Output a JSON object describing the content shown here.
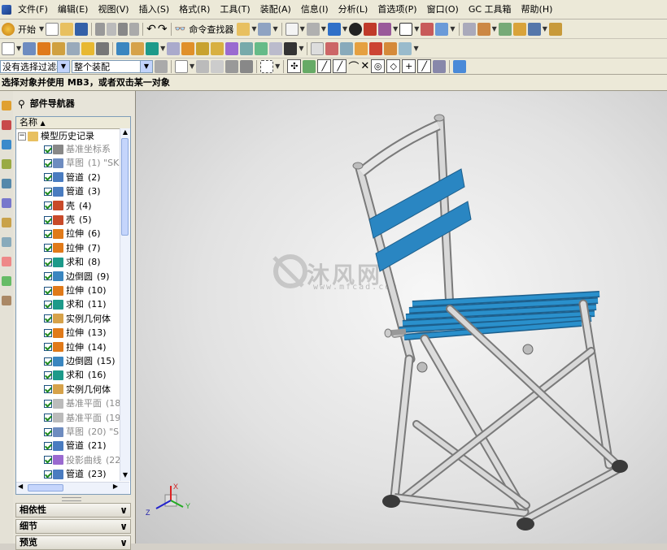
{
  "menubar": {
    "items": [
      "文件(F)",
      "编辑(E)",
      "视图(V)",
      "插入(S)",
      "格式(R)",
      "工具(T)",
      "装配(A)",
      "信息(I)",
      "分析(L)",
      "首选项(P)",
      "窗口(O)",
      "GC 工具箱",
      "帮助(H)"
    ]
  },
  "toolbar": {
    "start_label": "开始",
    "command_finder_label": "命令查找器"
  },
  "selection_bar": {
    "filter_value": "没有选择过滤器",
    "scope_value": "整个装配"
  },
  "cue_line": "选择对象并使用 MB3，或者双击某一对象",
  "navigator": {
    "title": "部件导航器",
    "column_name": "名称",
    "root_label": "模型历史记录",
    "rows": [
      {
        "label": "基准坐标系",
        "num": "",
        "gray": true,
        "icon": "datum-csys-icon"
      },
      {
        "label": "草图",
        "num": "(1) \"SK",
        "gray": true,
        "icon": "sketch-icon"
      },
      {
        "label": "管道",
        "num": "(2)",
        "gray": false,
        "icon": "tube-icon"
      },
      {
        "label": "管道",
        "num": "(3)",
        "gray": false,
        "icon": "tube-icon"
      },
      {
        "label": "壳",
        "num": "(4)",
        "gray": false,
        "icon": "shell-icon"
      },
      {
        "label": "壳",
        "num": "(5)",
        "gray": false,
        "icon": "shell-icon"
      },
      {
        "label": "拉伸",
        "num": "(6)",
        "gray": false,
        "icon": "extrude-icon"
      },
      {
        "label": "拉伸",
        "num": "(7)",
        "gray": false,
        "icon": "extrude-icon"
      },
      {
        "label": "求和",
        "num": "(8)",
        "gray": false,
        "icon": "unite-icon"
      },
      {
        "label": "边倒圆",
        "num": "(9)",
        "gray": false,
        "icon": "edge-blend-icon"
      },
      {
        "label": "拉伸",
        "num": "(10)",
        "gray": false,
        "icon": "extrude-icon"
      },
      {
        "label": "求和",
        "num": "(11)",
        "gray": false,
        "icon": "unite-icon"
      },
      {
        "label": "实例几何体",
        "num": "",
        "gray": false,
        "icon": "instance-geometry-icon"
      },
      {
        "label": "拉伸",
        "num": "(13)",
        "gray": false,
        "icon": "extrude-icon"
      },
      {
        "label": "拉伸",
        "num": "(14)",
        "gray": false,
        "icon": "extrude-icon"
      },
      {
        "label": "边倒圆",
        "num": "(15)",
        "gray": false,
        "icon": "edge-blend-icon"
      },
      {
        "label": "求和",
        "num": "(16)",
        "gray": false,
        "icon": "unite-icon"
      },
      {
        "label": "实例几何体",
        "num": "",
        "gray": false,
        "icon": "instance-geometry-icon"
      },
      {
        "label": "基准平面",
        "num": "(18",
        "gray": true,
        "icon": "datum-plane-icon"
      },
      {
        "label": "基准平面",
        "num": "(19",
        "gray": true,
        "icon": "datum-plane-icon"
      },
      {
        "label": "草图",
        "num": "(20) \"S",
        "gray": true,
        "icon": "sketch-icon"
      },
      {
        "label": "管道",
        "num": "(21)",
        "gray": false,
        "icon": "tube-icon"
      },
      {
        "label": "投影曲线",
        "num": "(22",
        "gray": true,
        "icon": "projected-curve-icon"
      },
      {
        "label": "管道",
        "num": "(23)",
        "gray": false,
        "icon": "tube-icon"
      }
    ],
    "panels": [
      "相依性",
      "细节",
      "预览"
    ]
  },
  "viewport": {
    "watermark_text": "沐风网",
    "watermark_url": "www.mfcad.com",
    "triad": {
      "x_label": "X",
      "y_label": "Y",
      "z_label": "Z"
    }
  },
  "colors": {
    "seat_blue": "#2a86c2",
    "frame_gray": "#c8c8c8",
    "foot_dark": "#3a3a3a"
  }
}
